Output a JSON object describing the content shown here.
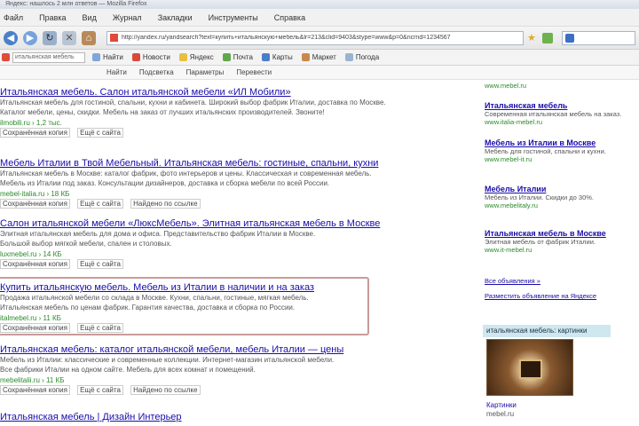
{
  "window": {
    "title": "Яндекс: нашлось 2 млн ответов — Mozilla Firefox"
  },
  "menu": [
    "Файл",
    "Правка",
    "Вид",
    "Журнал",
    "Закладки",
    "Инструменты",
    "Справка"
  ],
  "nav": {
    "url": "http://yandex.ru/yandsearch?text=купить+итальянскую+мебель&lr=213&clid=9403&stype=www&p=0&ncrnd=1234567",
    "search_placeholder": "Яндекс"
  },
  "bookmarks": {
    "input_value": "итальянская мебель",
    "items": [
      "Найти",
      "Новости",
      "Яндекс",
      "Почта",
      "Карты",
      "Маркет",
      "Погода"
    ]
  },
  "toolbar2": [
    "Найти",
    "Подсветка",
    "Параметры",
    "Перевести"
  ],
  "results": [
    {
      "title": "Итальянская мебель. Салон итальянской мебели «ИЛ Мобили»",
      "snippet1": "Итальянская мебель для гостиной, спальни, кухни и кабинета. Широкий выбор фабрик Италии, доставка по Москве.",
      "snippet2": "Каталог мебели, цены, скидки. Мебель на заказ от лучших итальянских производителей. Звоните!",
      "url": "ilmobili.ru › 1,2 тыс.",
      "links": [
        "Сохранённая копия",
        "Ещё с сайта"
      ]
    },
    {
      "title": "Мебель Италии в Твой Мебельный. Итальянская мебель: гостиные, спальни, кухни",
      "snippet1": "Итальянская мебель в Москве: каталог фабрик, фото интерьеров и цены. Классическая и современная мебель.",
      "snippet2": "Мебель из Италии под заказ. Консультации дизайнеров, доставка и сборка мебели по всей России.",
      "url": "mebel-italia.ru › 18 КБ",
      "links": [
        "Сохранённая копия",
        "Ещё с сайта",
        "Найдено по ссылке"
      ]
    },
    {
      "title": "Салон итальянской мебели «ЛюксМебель». Элитная итальянская мебель в Москве",
      "snippet1": "Элитная итальянская мебель для дома и офиса. Представительство фабрик Италии в Москве.",
      "snippet2": "Большой выбор мягкой мебели, спален и столовых.",
      "url": "luxmebel.ru › 14 КБ",
      "links": [
        "Сохранённая копия",
        "Ещё с сайта"
      ]
    },
    {
      "title": "Купить итальянскую мебель. Мебель из Италии в наличии и на заказ",
      "snippet1": "Продажа итальянской мебели со склада в Москве. Кухни, спальни, гостиные, мягкая мебель.",
      "snippet2": "Итальянская мебель по ценам фабрик. Гарантия качества, доставка и сборка по России.",
      "url": "italmebel.ru › 11 КБ",
      "links": [
        "Сохранённая копия",
        "Ещё с сайта"
      ]
    },
    {
      "title": "Итальянская мебель: каталог итальянской мебели, мебель Италии — цены",
      "snippet1": "Мебель из Италии: классические и современные коллекции. Интернет-магазин итальянской мебели.",
      "snippet2": "Все фабрики Италии на одном сайте. Мебель для всех комнат и помещений.",
      "url": "mebelitalii.ru › 11 КБ",
      "links": [
        "Сохранённая копия",
        "Ещё с сайта",
        "Найдено по ссылке"
      ]
    },
    {
      "title": "Итальянская мебель | Дизайн Интерьер"
    }
  ],
  "sidebar": {
    "ads": [
      {
        "title": "",
        "text": "",
        "url": "www.mebel.ru"
      },
      {
        "title": "Итальянская мебель",
        "text": "Современная итальянская мебель на заказ.",
        "url": "www.italia-mebel.ru"
      },
      {
        "title": "Мебель из Италии в Москве",
        "text": "Мебель для гостиной, спальни и кухни.",
        "url": "www.mebel-it.ru"
      },
      {
        "title": "Мебель Италии",
        "text": "Мебель из Италии. Скидки до 30%.",
        "url": "www.mebelitaly.ru"
      },
      {
        "title": "Итальянская мебель в Москве",
        "text": "Элитная мебель от фабрик Италии.",
        "url": "www.it-mebel.ru"
      }
    ],
    "more_link": "Все объявления »",
    "extra_text": "Разместить объявление на Яндексе",
    "image_block_title": "итальянская мебель: картинки",
    "image_caption": "Картинки",
    "image_caption2": "mebel.ru"
  }
}
